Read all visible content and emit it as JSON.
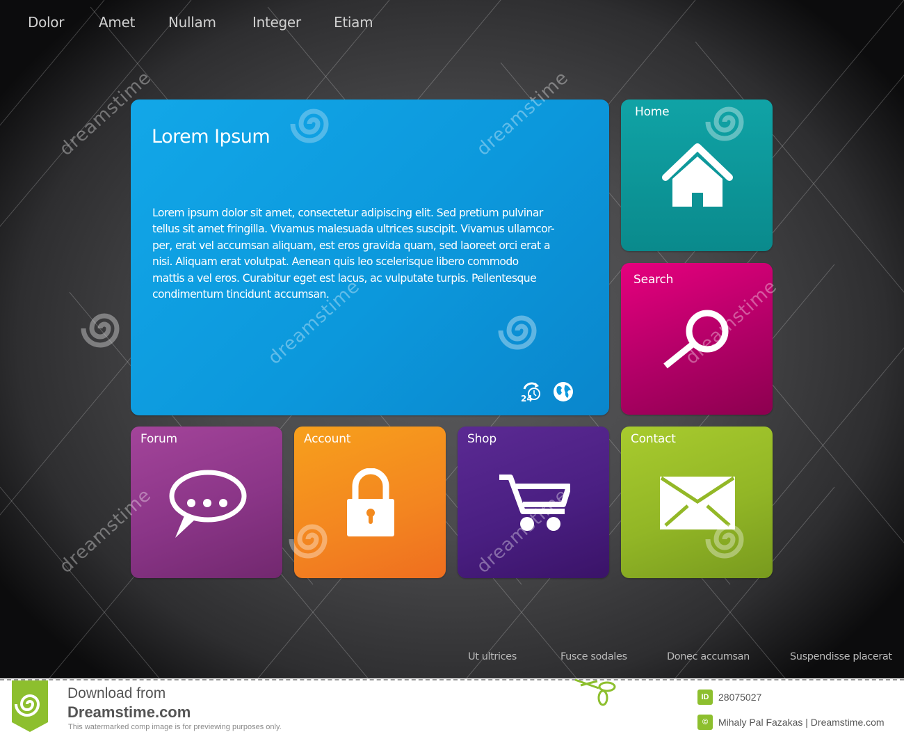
{
  "top_nav": {
    "items": [
      {
        "label": "Dolor"
      },
      {
        "label": "Amet"
      },
      {
        "label": "Nullam"
      },
      {
        "label": "Integer"
      },
      {
        "label": "Etiam"
      }
    ]
  },
  "main_panel": {
    "title": "Lorem Ipsum",
    "body": "Lorem ipsum dolor sit amet, consectetur adipiscing elit. Sed pretium pulvinar tellus sit amet fringilla. Vivamus malesuada ultrices suscipit. Vivamus ullamcor-per, erat vel accumsan aliquam, est eros gravida quam, sed laoreet orci erat a nisi. Aliquam erat volutpat. Aenean quis leo scelerisque libero commodo mattis a vel eros. Curabitur eget est lacus, ac vulputate turpis. Pellentesque condimentum tincidunt accumsan.",
    "body_lines": [
      "Lorem ipsum dolor sit amet, consectetur adipiscing elit. Sed pretium pulvinar",
      "tellus sit amet fringilla. Vivamus malesuada ultrices suscipit. Vivamus ullamcor-",
      "per, erat vel accumsan aliquam, est eros gravida quam, sed laoreet orci erat a",
      "nisi. Aliquam erat volutpat. Aenean quis leo scelerisque libero commodo",
      "mattis a vel eros. Curabitur eget est lacus, ac vulputate turpis. Pellentesque",
      "condimentum tincidunt accumsan."
    ],
    "icons": [
      "24-hour-support-icon",
      "globe-icon"
    ]
  },
  "tiles": [
    {
      "label": "Home",
      "icon": "home-icon",
      "color": "#0e9a9c"
    },
    {
      "label": "Search",
      "icon": "search-icon",
      "color": "#c8006f"
    },
    {
      "label": "Forum",
      "icon": "speech-bubble-icon",
      "color": "#8e3a8b"
    },
    {
      "label": "Account",
      "icon": "padlock-icon",
      "color": "#f38a1f"
    },
    {
      "label": "Shop",
      "icon": "shopping-cart-icon",
      "color": "#4a1f82"
    },
    {
      "label": "Contact",
      "icon": "envelope-icon",
      "color": "#93b827"
    }
  ],
  "footer_nav": {
    "items": [
      {
        "label": "Ut ultrices"
      },
      {
        "label": "Fusce sodales"
      },
      {
        "label": "Donec accumsan"
      },
      {
        "label": "Suspendisse placerat"
      }
    ]
  },
  "watermark": {
    "text": "dreamstime",
    "download_from": "Download from",
    "site": "Dreamstime.com",
    "note": "This watermarked comp image is for previewing purposes only.",
    "id_badge": "ID",
    "id_value": "28075027",
    "credit": "Mihaly Pal Fazakas | Dreamstime.com",
    "accent": "#8dbf2e"
  }
}
